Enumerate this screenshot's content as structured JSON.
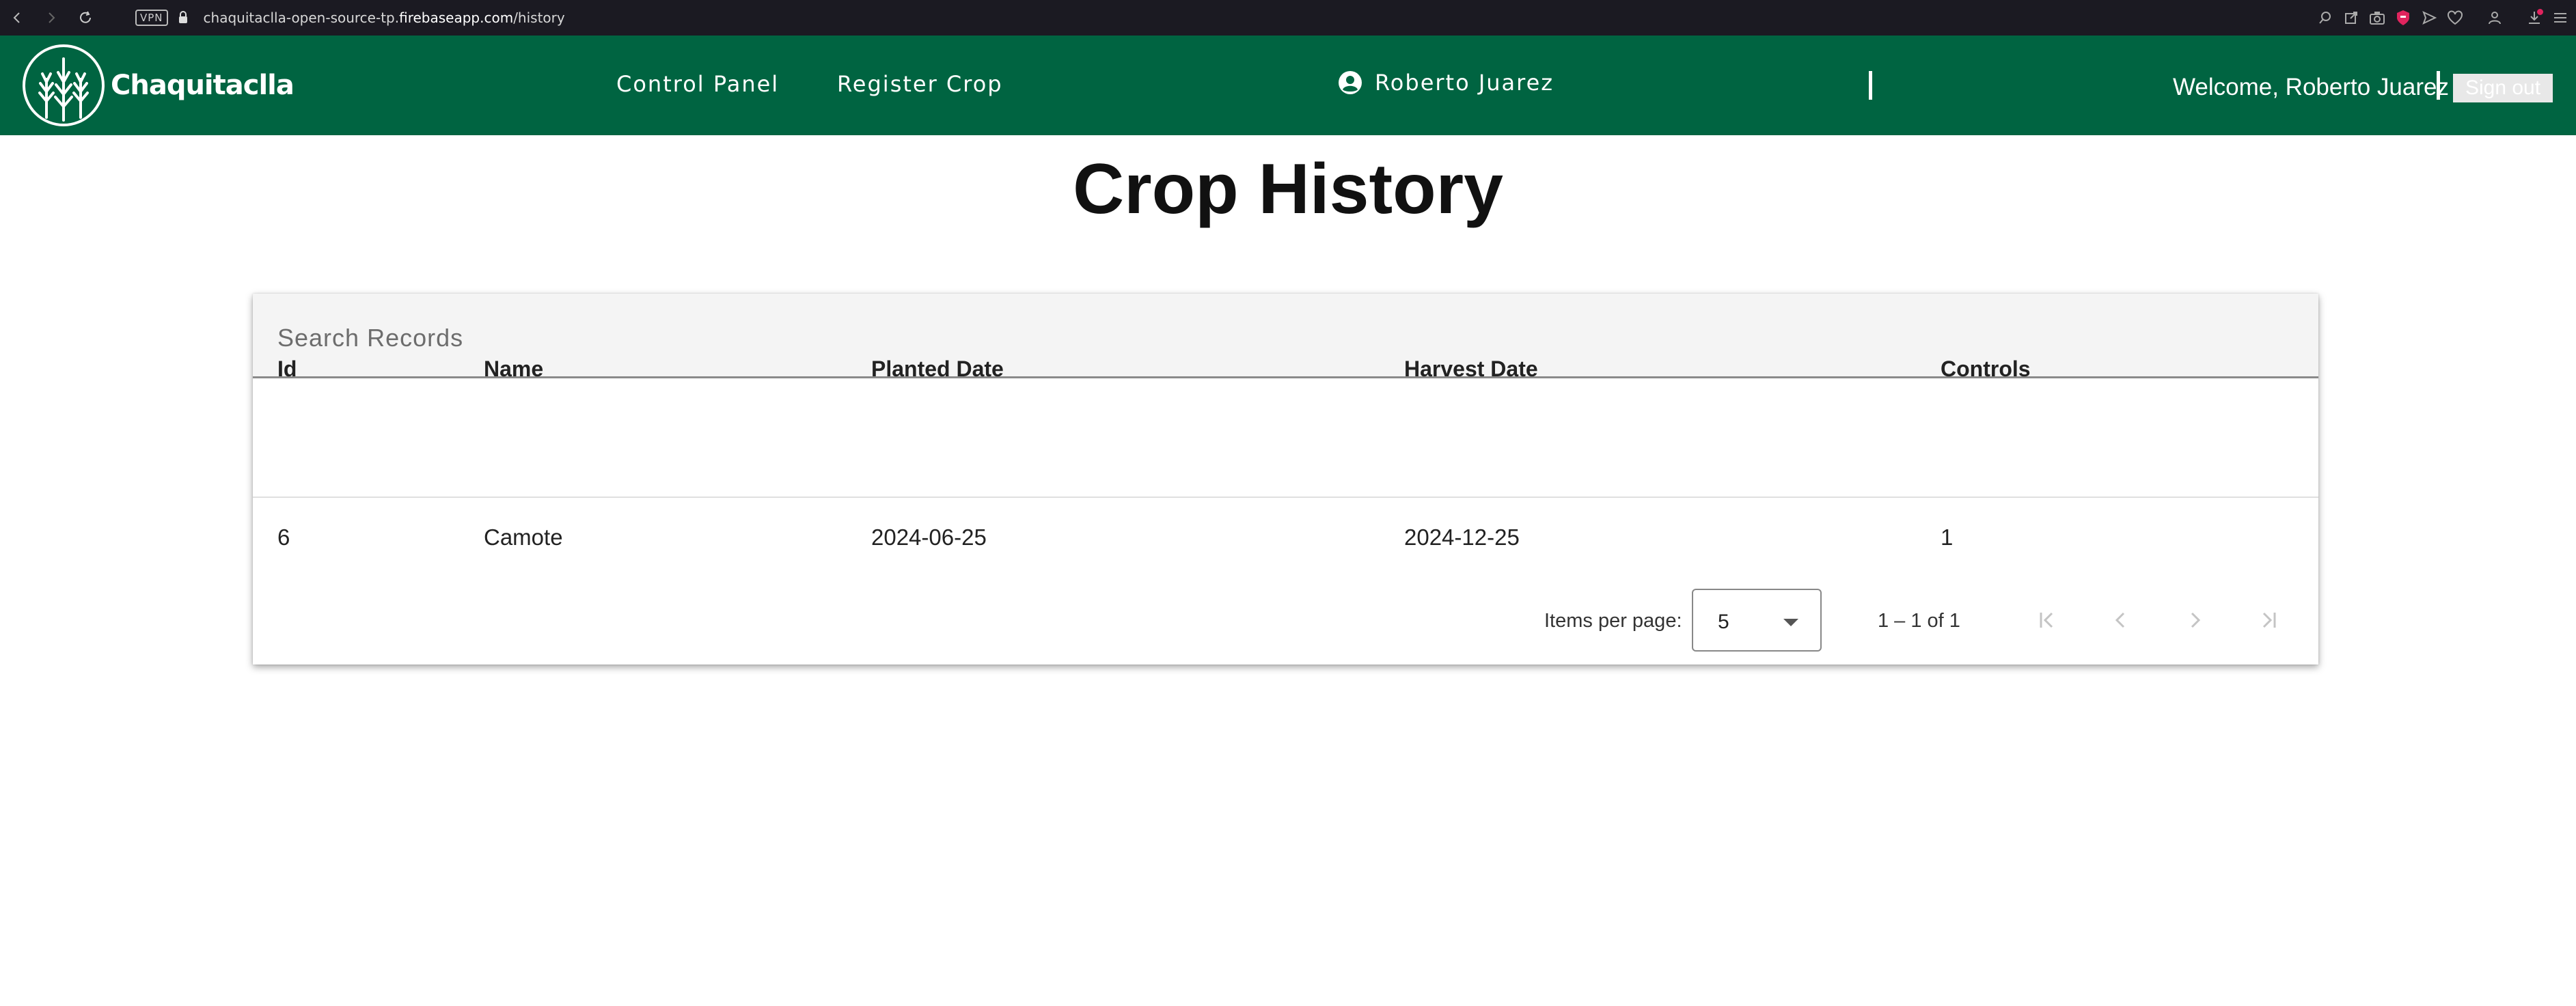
{
  "browser": {
    "vpn_label": "VPN",
    "url_prefix": "chaquitaclla-open-source-tp.",
    "url_host": "firebaseapp.com",
    "url_path": "/history"
  },
  "header": {
    "brand": "Chaquitaclla",
    "nav": {
      "control_panel": "Control Panel",
      "register_crop": "Register Crop"
    },
    "user_name": "Roberto Juarez",
    "welcome": "Welcome, Roberto Juarez",
    "sign_out": "Sign out",
    "bg_color": "#006441"
  },
  "page": {
    "title": "Crop History"
  },
  "search": {
    "placeholder": "Search Records",
    "value": ""
  },
  "table": {
    "columns": [
      "Id",
      "Name",
      "Planted Date",
      "Harvest Date",
      "Controls"
    ],
    "rows": [
      [
        "6",
        "Camote",
        "2024-06-25",
        "2024-12-25",
        "1"
      ]
    ]
  },
  "paginator": {
    "items_per_page_label": "Items per page:",
    "page_size": "5",
    "range": "1 – 1 of 1"
  }
}
